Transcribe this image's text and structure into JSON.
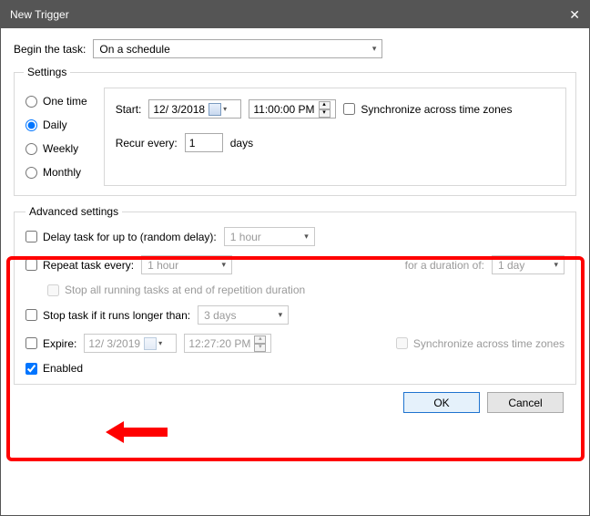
{
  "window": {
    "title": "New Trigger"
  },
  "begin": {
    "label": "Begin the task:",
    "value": "On a schedule"
  },
  "settings": {
    "legend": "Settings",
    "radios": {
      "one_time": "One time",
      "daily": "Daily",
      "weekly": "Weekly",
      "monthly": "Monthly",
      "selected": "daily"
    },
    "start_label": "Start:",
    "start_date": "12/  3/2018",
    "start_time": "11:00:00 PM",
    "sync_label": "Synchronize across time zones",
    "recur_label": "Recur every:",
    "recur_value": "1",
    "recur_unit": "days"
  },
  "advanced": {
    "legend": "Advanced settings",
    "delay_label": "Delay task for up to (random delay):",
    "delay_value": "1 hour",
    "repeat_label": "Repeat task every:",
    "repeat_value": "1 hour",
    "duration_label": "for a duration of:",
    "duration_value": "1 day",
    "stop_all_label": "Stop all running tasks at end of repetition duration",
    "stop_if_label": "Stop task if it runs longer than:",
    "stop_if_value": "3 days",
    "expire_label": "Expire:",
    "expire_date": "12/  3/2019",
    "expire_time": "12:27:20 PM",
    "expire_sync_label": "Synchronize across time zones",
    "enabled_label": "Enabled"
  },
  "buttons": {
    "ok": "OK",
    "cancel": "Cancel"
  }
}
